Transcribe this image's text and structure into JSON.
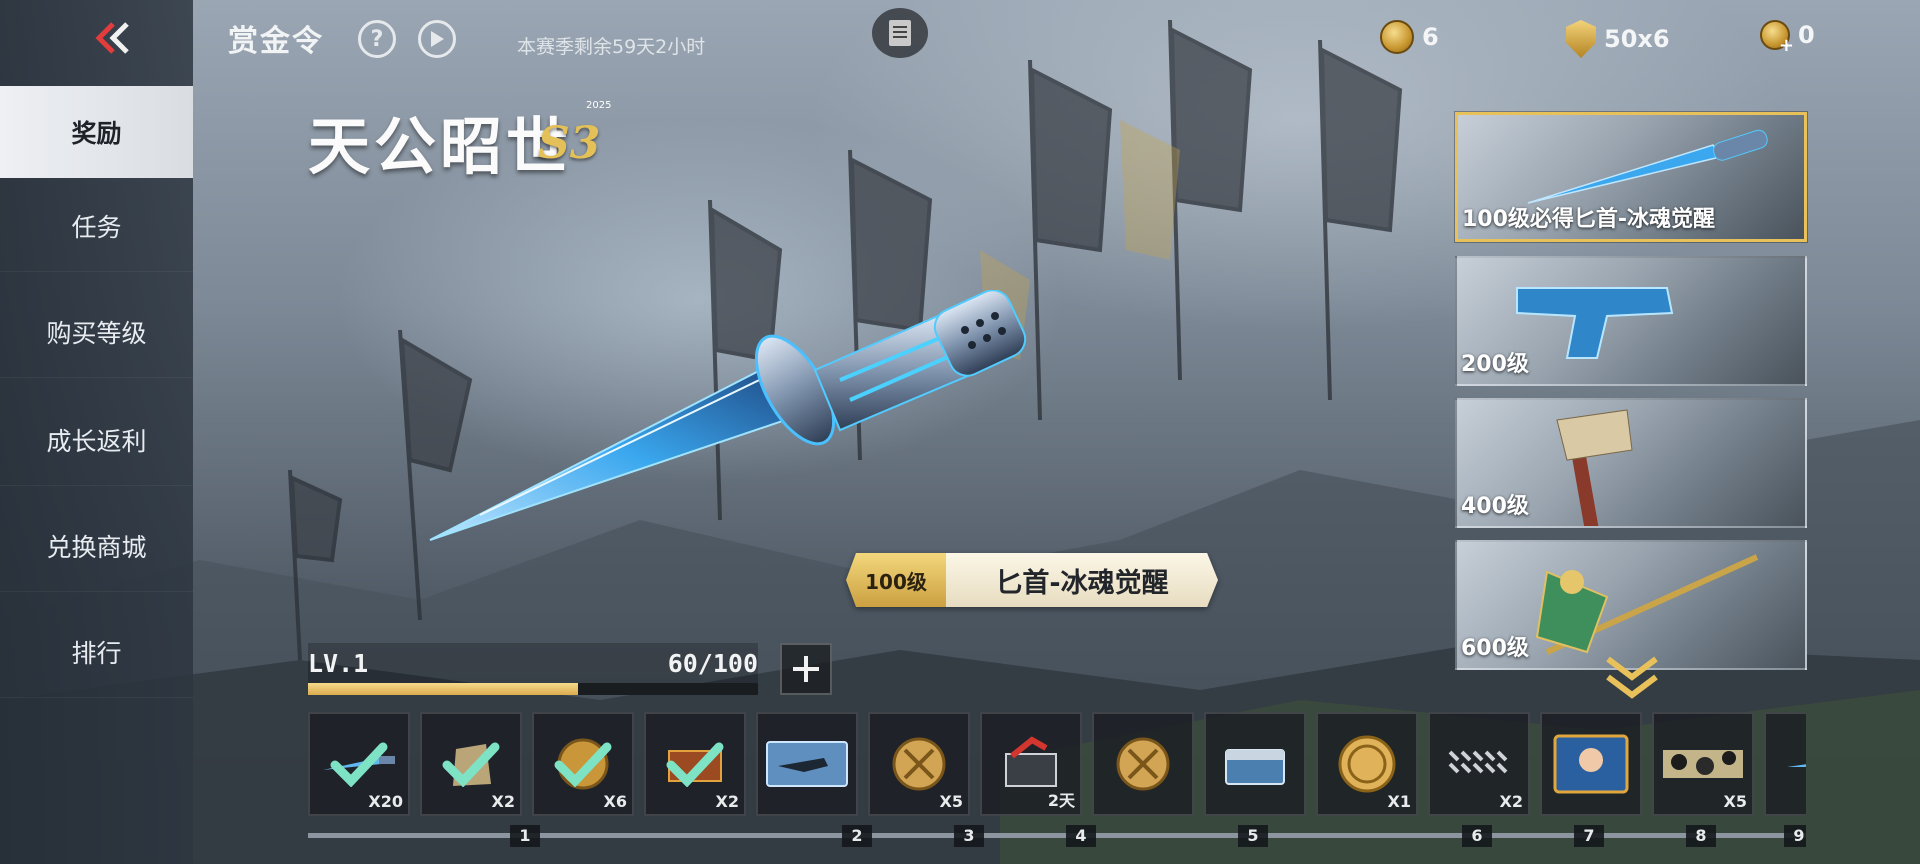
{
  "header": {
    "title": "赏金令",
    "help_icon": "question-circle-icon",
    "play_icon": "play-circle-icon",
    "season_remaining": "本赛季剩余59天2小时",
    "notes_icon": "notes-icon"
  },
  "currencies": [
    {
      "icon": "gold-coin-icon",
      "value": "6"
    },
    {
      "icon": "gold-shield-icon",
      "value": "50x6"
    },
    {
      "icon": "coin-plus-icon",
      "value": "0"
    }
  ],
  "sidebar": {
    "back_icon": "double-chevron-left-icon",
    "items": [
      {
        "label": "奖励",
        "active": true
      },
      {
        "label": "任务",
        "active": false
      },
      {
        "label": "购买等级",
        "active": false
      },
      {
        "label": "成长返利",
        "active": false
      },
      {
        "label": "兑换商城",
        "active": false
      },
      {
        "label": "排行",
        "active": false
      }
    ]
  },
  "logo": {
    "text": "天公昭世",
    "season": "S3",
    "year": "2025"
  },
  "featured_reward": {
    "level": "100级",
    "name": "匕首-冰魂觉醒"
  },
  "level": {
    "label": "LV.1",
    "progress_text": "60/100",
    "progress_fraction": 0.6
  },
  "reward_cards": [
    {
      "label": "100级必得匕首-冰魂觉醒",
      "selected": true,
      "item": "dagger"
    },
    {
      "label": "200级",
      "selected": false,
      "item": "pistol"
    },
    {
      "label": "400级",
      "selected": false,
      "item": "axe"
    },
    {
      "label": "600级",
      "selected": false,
      "item": "halberd"
    }
  ],
  "reward_strip": {
    "slots": [
      {
        "icon": "knife-icon",
        "qty": "X20",
        "claimed": true
      },
      {
        "icon": "sack-icon",
        "qty": "X2",
        "claimed": true
      },
      {
        "icon": "gold-coin-icon",
        "qty": "X6",
        "claimed": true
      },
      {
        "icon": "crate-icon",
        "qty": "X2",
        "claimed": true
      },
      {
        "icon": "weapon-card-icon",
        "qty": "",
        "claimed": false
      },
      {
        "icon": "crossed-swords-coin-icon",
        "qty": "X5",
        "claimed": false
      },
      {
        "icon": "mystery-box-icon",
        "qty": "2天",
        "claimed": false
      },
      {
        "icon": "crossed-swords-coin-icon",
        "qty": "",
        "claimed": false
      },
      {
        "icon": "supply-chest-icon",
        "qty": "",
        "claimed": false
      },
      {
        "icon": "gold-coin-icon",
        "qty": "X1",
        "claimed": false
      },
      {
        "icon": "bullets-icon",
        "qty": "X2",
        "claimed": false
      },
      {
        "icon": "character-card-icon",
        "qty": "",
        "claimed": false
      },
      {
        "icon": "camo-skin-icon",
        "qty": "X5",
        "claimed": false
      },
      {
        "icon": "knife-icon",
        "qty": "",
        "claimed": false
      }
    ],
    "level_markers": [
      "1",
      "2",
      "3",
      "4",
      "5",
      "6",
      "7",
      "8",
      "9"
    ]
  }
}
